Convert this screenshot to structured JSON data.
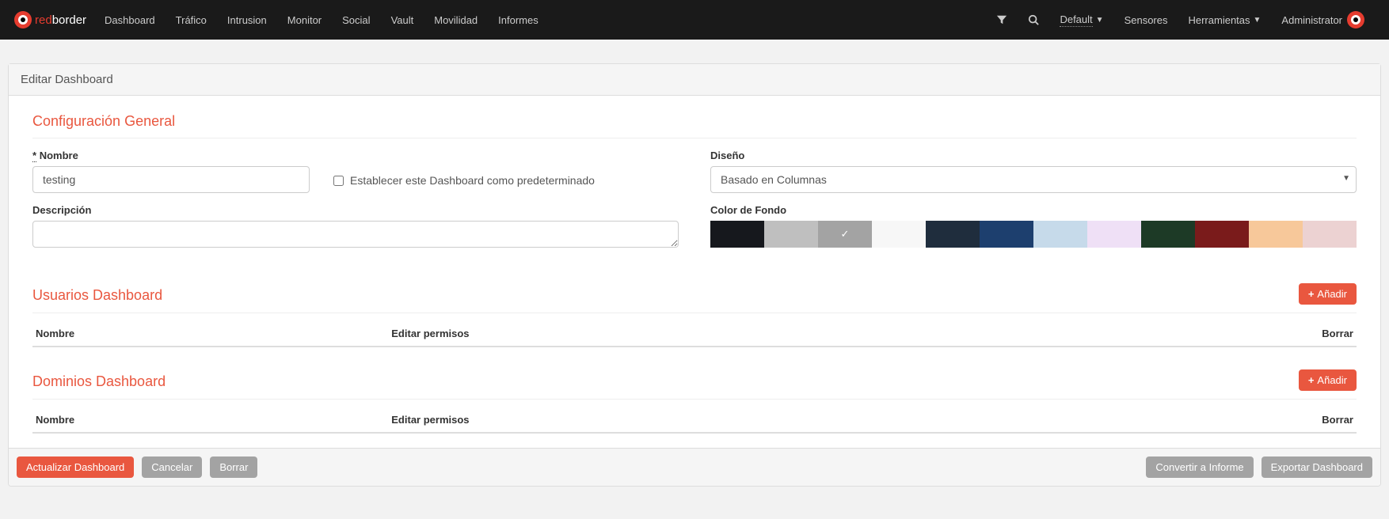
{
  "brand": {
    "red": "red",
    "white": "border"
  },
  "nav": {
    "items": [
      "Dashboard",
      "Tráfico",
      "Intrusion",
      "Monitor",
      "Social",
      "Vault",
      "Movilidad",
      "Informes"
    ],
    "default_label": "Default",
    "right": [
      "Sensores",
      "Herramientas",
      "Administrator"
    ]
  },
  "panel": {
    "title": "Editar Dashboard"
  },
  "general": {
    "section": "Configuración General",
    "name_label": "Nombre",
    "name_value": "testing",
    "default_checkbox": "Establecer este Dashboard como predeterminado",
    "desc_label": "Descripción",
    "desc_value": "",
    "design_label": "Diseño",
    "design_value": "Basado en Columnas",
    "bgcolor_label": "Color de Fondo",
    "colors": [
      {
        "hex": "#16181d",
        "selected": false
      },
      {
        "hex": "#bfbfbf",
        "selected": false
      },
      {
        "hex": "#a3a3a3",
        "selected": true
      },
      {
        "hex": "#f7f7f7",
        "selected": false
      },
      {
        "hex": "#1f2d3d",
        "selected": false
      },
      {
        "hex": "#1d3f6e",
        "selected": false
      },
      {
        "hex": "#c6daea",
        "selected": false
      },
      {
        "hex": "#efe0f6",
        "selected": false
      },
      {
        "hex": "#1d3a26",
        "selected": false
      },
      {
        "hex": "#7a1b1b",
        "selected": false
      },
      {
        "hex": "#f7c89a",
        "selected": false
      },
      {
        "hex": "#ecd2d2",
        "selected": false
      }
    ]
  },
  "users": {
    "section": "Usuarios Dashboard",
    "add": "Añadir",
    "th_name": "Nombre",
    "th_perm": "Editar permisos",
    "th_del": "Borrar"
  },
  "domains": {
    "section": "Dominios Dashboard",
    "add": "Añadir",
    "th_name": "Nombre",
    "th_perm": "Editar permisos",
    "th_del": "Borrar"
  },
  "footer": {
    "update": "Actualizar Dashboard",
    "cancel": "Cancelar",
    "delete": "Borrar",
    "convert": "Convertir a Informe",
    "export": "Exportar Dashboard"
  }
}
